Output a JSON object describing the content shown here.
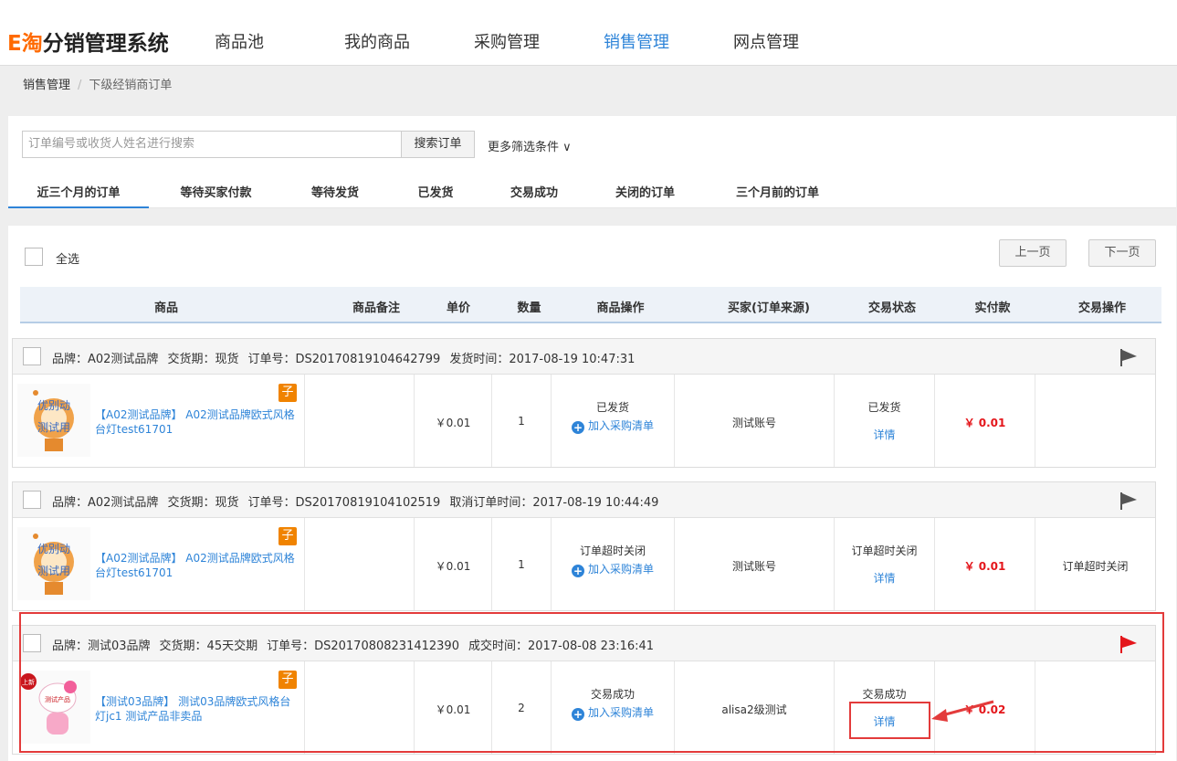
{
  "header": {
    "logo_e": "E淘",
    "logo_rest": "分销管理系统",
    "nav": [
      "商品池",
      "我的商品",
      "采购管理",
      "销售管理",
      "网点管理"
    ],
    "active_index": 3
  },
  "breadcrumb": {
    "root": "销售管理",
    "sep": "/",
    "current": "下级经销商订单"
  },
  "search": {
    "placeholder": "订单编号或收货人姓名进行搜索",
    "button": "搜索订单",
    "more": "更多筛选条件 ∨"
  },
  "tabs": [
    "近三个月的订单",
    "等待买家付款",
    "等待发货",
    "已发货",
    "交易成功",
    "关闭的订单",
    "三个月前的订单"
  ],
  "list": {
    "select_all": "全选",
    "prev": "上一页",
    "next": "下一页",
    "columns": [
      "商品",
      "商品备注",
      "单价",
      "数量",
      "商品操作",
      "买家(订单来源)",
      "交易状态",
      "实付款",
      "交易操作"
    ]
  },
  "orders": [
    {
      "brand": "品牌：A02测试品牌",
      "delivery": "交货期：现货",
      "order_no": "订单号：DS20170819104642799",
      "time": "发货时间：2017-08-19 10:47:31",
      "flag_color": "#555555",
      "badge": "子",
      "product": "【A02测试品牌】 A02测试品牌欧式风格台灯test61701",
      "remark": "",
      "price": "￥0.01",
      "qty": "1",
      "item_status": "已发货",
      "add_link": "加入采购清单",
      "buyer": "测试账号",
      "trade_status": "已发货",
      "detail": "详情",
      "paid": "￥ 0.01",
      "trade_op": ""
    },
    {
      "brand": "品牌：A02测试品牌",
      "delivery": "交货期：现货",
      "order_no": "订单号：DS20170819104102519",
      "time": "取消订单时间：2017-08-19 10:44:49",
      "flag_color": "#555555",
      "badge": "子",
      "product": "【A02测试品牌】 A02测试品牌欧式风格台灯test61701",
      "remark": "",
      "price": "￥0.01",
      "qty": "1",
      "item_status": "订单超时关闭",
      "add_link": "加入采购清单",
      "buyer": "测试账号",
      "trade_status": "订单超时关闭",
      "detail": "详情",
      "paid": "￥ 0.01",
      "trade_op": "订单超时关闭"
    },
    {
      "brand": "品牌：测试03品牌",
      "delivery": "交货期：45天交期",
      "order_no": "订单号：DS20170808231412390",
      "time": "成交时间：2017-08-08 23:16:41",
      "flag_color": "#e4161b",
      "badge": "子",
      "product": "【测试03品牌】 测试03品牌欧式风格台灯jc1 测试产品非卖品",
      "remark": "",
      "price": "￥0.01",
      "qty": "2",
      "item_status": "交易成功",
      "add_link": "加入采购清单",
      "buyer": "alisa2级测试",
      "trade_status": "交易成功",
      "detail": "详情",
      "paid": "￥ 0.02",
      "trade_op": ""
    }
  ],
  "thumb_text": {
    "robot_line1": "优别动",
    "robot_line2": "测试用",
    "kitty_label": "测试产品",
    "kitty_stamp": "上新"
  },
  "colors": {
    "accent": "#2e84d8",
    "price": "#e4161b",
    "highlight": "#e33b3b",
    "badge": "#f08300"
  }
}
